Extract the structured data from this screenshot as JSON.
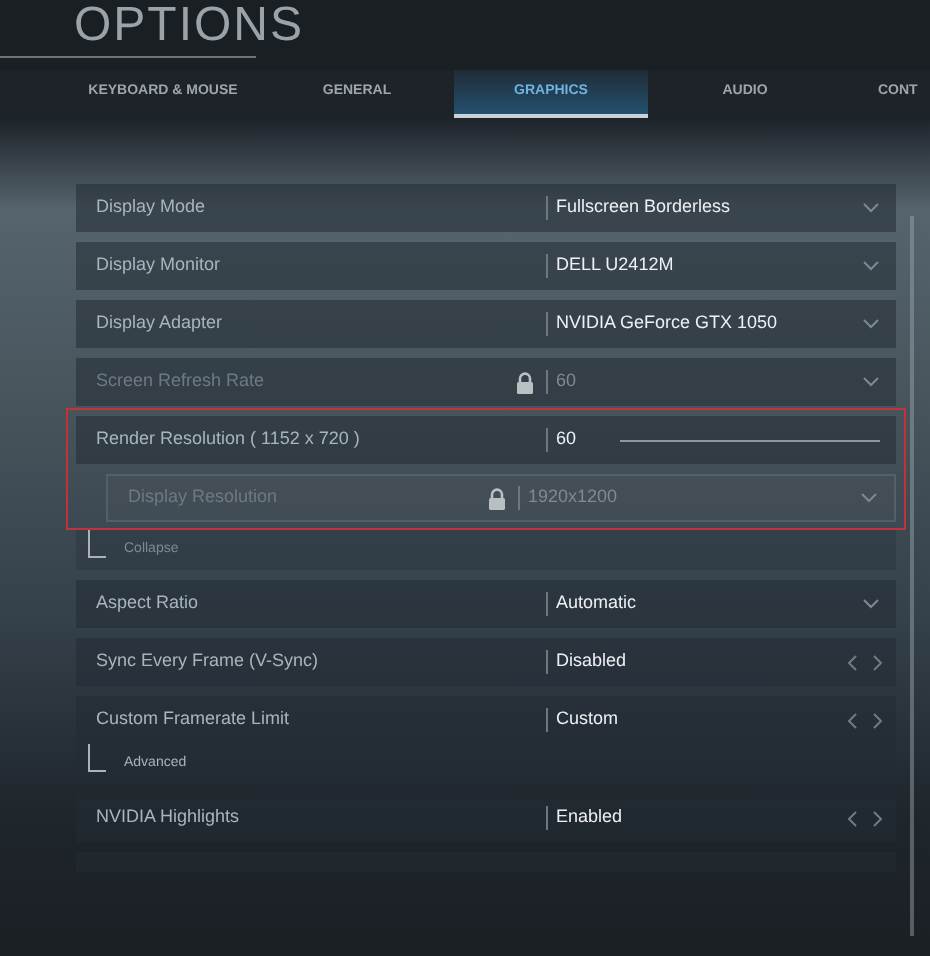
{
  "title": "OPTIONS",
  "tabs": [
    {
      "label": "KEYBOARD & MOUSE",
      "selected": false
    },
    {
      "label": "GENERAL",
      "selected": false
    },
    {
      "label": "GRAPHICS",
      "selected": true
    },
    {
      "label": "AUDIO",
      "selected": false
    },
    {
      "label": "CONT",
      "selected": false
    }
  ],
  "settings": [
    {
      "label": "Display Mode",
      "value": "Fullscreen Borderless",
      "kind": "dropdown",
      "locked": false,
      "disabled": false
    },
    {
      "label": "Display Monitor",
      "value": "DELL U2412M",
      "kind": "dropdown",
      "locked": false,
      "disabled": false
    },
    {
      "label": "Display Adapter",
      "value": "NVIDIA GeForce GTX 1050",
      "kind": "dropdown",
      "locked": false,
      "disabled": false
    },
    {
      "label": "Screen Refresh Rate",
      "value": "60",
      "kind": "dropdown",
      "locked": true,
      "disabled": true
    },
    {
      "label": "Render Resolution ( 1152 x 720 )",
      "value": "60",
      "kind": "slider",
      "locked": false,
      "disabled": false,
      "highlighted": true,
      "expanded": true,
      "toggle": "Collapse",
      "children": [
        {
          "label": "Display Resolution",
          "value": "1920x1200",
          "kind": "dropdown",
          "locked": true,
          "disabled": true
        }
      ]
    },
    {
      "label": "Aspect Ratio",
      "value": "Automatic",
      "kind": "dropdown",
      "locked": false,
      "disabled": false
    },
    {
      "label": "Sync Every Frame (V-Sync)",
      "value": "Disabled",
      "kind": "arrows",
      "locked": false,
      "disabled": false
    },
    {
      "label": "Custom Framerate Limit",
      "value": "Custom",
      "kind": "arrows",
      "locked": false,
      "disabled": false,
      "expanded": false,
      "toggle": "Advanced"
    },
    {
      "label": "NVIDIA Highlights",
      "value": "Enabled",
      "kind": "arrows",
      "locked": false,
      "disabled": false
    },
    {
      "kind": "cut"
    }
  ]
}
